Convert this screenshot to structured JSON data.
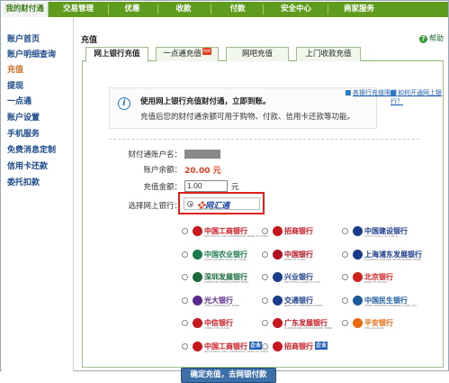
{
  "topnav": {
    "tabs": [
      "我的财付通",
      "交易管理",
      "优惠",
      "收款",
      "付款",
      "安全中心",
      "商家服务"
    ]
  },
  "sidebar": {
    "items": [
      "账户首页",
      "账户明细查询",
      "充值",
      "提现",
      "一点通",
      "账户设置",
      "手机服务",
      "免费消息定制",
      "信用卡还款",
      "委托扣款"
    ],
    "active_index": 2
  },
  "header": {
    "breadcrumb": "充值",
    "help": "帮助"
  },
  "tabs": [
    {
      "label": "网上银行充值",
      "selected": true
    },
    {
      "label": "一点通充值",
      "selected": false,
      "hot_badge": "hot"
    },
    {
      "label": "网吧充值",
      "selected": false
    },
    {
      "label": "上门收款充值",
      "selected": false
    }
  ],
  "notice": {
    "title": "使用网上银行充值财付通，立即到账。",
    "text": "充值后您的财付通余额可用于购物、付款、信用卡还款等功能。",
    "link1": "各银行充值限额",
    "link2": "如何开通网上银行？"
  },
  "form": {
    "account_label": "财付通账户名：",
    "balance_label": "账户余额：",
    "balance_value": "20.00 元",
    "amount_label": "充值金额：",
    "amount_value": "1.00",
    "amount_unit": "元",
    "bank_label": "选择网上银行："
  },
  "wanghuitong": {
    "logo": "网汇通",
    "sub": "www.udpay.com.cn"
  },
  "banks": [
    {
      "name": "中国工商银行",
      "en": "INDUSTRIAL AND COMMERCIAL BANK OF CHINA",
      "color": "#c8161d",
      "icon": "icbc-icon"
    },
    {
      "name": "招商银行",
      "en": "",
      "color": "#c8161d",
      "icon": "cmb-icon"
    },
    {
      "name": "中国建设银行",
      "en": "China Construction Bank",
      "color": "#1a3a8a",
      "icon": "ccb-icon"
    },
    {
      "name": "中国农业银行",
      "en": "AGRICULTURAL BANK OF CHINA",
      "color": "#1a7a4a",
      "icon": "abc-icon"
    },
    {
      "name": "中国银行",
      "en": "BANK OF CHINA",
      "color": "#b01020",
      "icon": "boc-icon"
    },
    {
      "name": "上海浦东发展银行",
      "en": "SHANGHAI PUDONG DEVELOPMENT BANK",
      "color": "#1a3a8a",
      "icon": "spdb-icon"
    },
    {
      "name": "深圳发展银行",
      "en": "SHENZHEN DEVELOPMENT BANK",
      "color": "#1a6a3a",
      "icon": "sdb-icon"
    },
    {
      "name": "兴业银行",
      "en": "INDUSTRIAL BANK CO.,LTD.",
      "color": "#1a3a8a",
      "icon": "cib-icon"
    },
    {
      "name": "北京银行",
      "en": "BANK OF BEIJING",
      "color": "#d2201a",
      "icon": "bob-icon"
    },
    {
      "name": "光大银行",
      "en": "CHINA EVERBRIGHT BANK",
      "color": "#5a2a8a",
      "icon": "ceb-icon"
    },
    {
      "name": "交通银行",
      "en": "BANK OF COMMUNICATIONS",
      "color": "#1a3a8a",
      "icon": "bocom-icon"
    },
    {
      "name": "中国民生银行",
      "en": "CHINA MINSHENG BANKING CORP.,LTD.",
      "color": "#1a5a9a",
      "icon": "cmbc-icon"
    },
    {
      "name": "中信银行",
      "en": "CHINA CITIC BANK",
      "color": "#c8161d",
      "icon": "citic-icon"
    },
    {
      "name": "广东发展银行",
      "en": "GUANGDONG DEVELOPMENT BANK",
      "color": "#c8161d",
      "icon": "gdb-icon"
    },
    {
      "name": "平安银行",
      "en": "PING AN BANK",
      "color": "#e86a10",
      "icon": "pingan-icon"
    },
    {
      "name": "中国工商银行",
      "en": "INDUSTRIAL AND COMMERCIAL BANK OF CHINA",
      "color": "#c8161d",
      "icon": "icbc-icon",
      "badge": "企业"
    },
    {
      "name": "招商银行",
      "en": "",
      "color": "#c8161d",
      "icon": "cmb-icon",
      "badge": "企业"
    }
  ],
  "submit_label": "确定充值，去网银付款"
}
